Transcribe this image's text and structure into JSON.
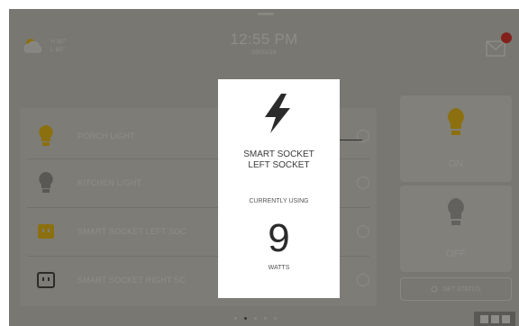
{
  "status_bar": {
    "weather": {
      "icon": "cloud-sun-icon",
      "high": "H 90°",
      "low": "L 80°"
    },
    "time": "12:55 PM",
    "date": "09/01/16",
    "message_icon": "envelope-icon",
    "message_badge_color": "#e03a2e"
  },
  "devices": [
    {
      "label": "PORCH LIGHT",
      "icon": "lightbulb-on-icon"
    },
    {
      "label": "KITCHEN LIGHT",
      "icon": "lightbulb-off-icon"
    },
    {
      "label": "SMART SOCKET LEFT SOC",
      "icon": "socket-on-icon"
    },
    {
      "label": "SMART SOCKET RIGHT SC",
      "icon": "socket-off-icon"
    }
  ],
  "controls": {
    "on_label": "ON",
    "off_label": "OFF",
    "set_status_label": "SET STATUS"
  },
  "pager": {
    "count": 5,
    "active": 1
  },
  "modal": {
    "icon": "lightning-bolt-icon",
    "device_line1": "SMART SOCKET",
    "device_line2": "LEFT SOCKET",
    "currently_using_label": "CURRENTLY USING",
    "value": "9",
    "unit": "WATTS"
  },
  "colors": {
    "accent_yellow": "#f2c21b",
    "screen_bg": "#cfcdc4",
    "modal_bg": "#ffffff"
  }
}
